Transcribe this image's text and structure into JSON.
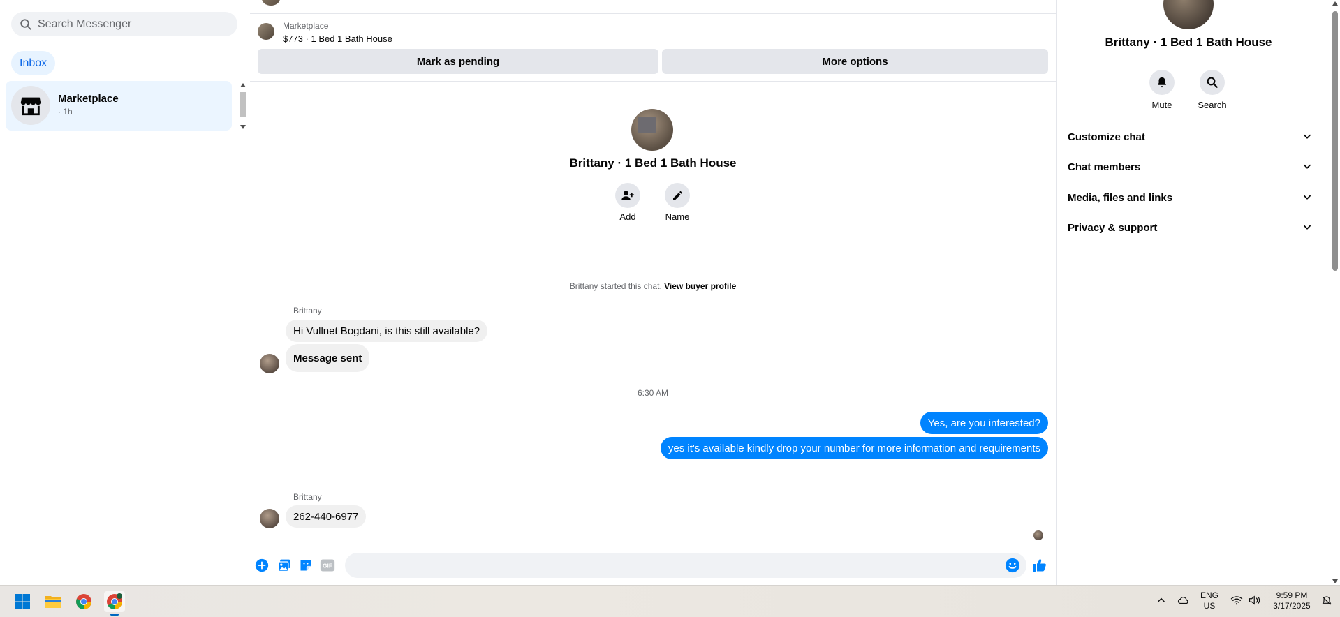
{
  "sidebar": {
    "search_placeholder": "Search Messenger",
    "inbox_tab": "Inbox",
    "conversation": {
      "title": "Marketplace",
      "time": "· 1h"
    }
  },
  "listing": {
    "source": "Marketplace",
    "item": "$773 · 1 Bed 1 Bath House",
    "mark_pending": "Mark as pending",
    "more_options": "More options"
  },
  "chat_header": {
    "name": "Brittany · 1 Bed 1 Bath House",
    "add_label": "Add",
    "name_label": "Name"
  },
  "thread": {
    "started_text": "Brittany started this chat.",
    "view_profile": "View buyer profile",
    "sender": "Brittany",
    "msg1": "Hi Vullnet Bogdani, is this still available?",
    "msg2": "Message sent",
    "timestamp": "6:30 AM",
    "reply1": "Yes, are you interested?",
    "reply2": "yes it's available kindly drop your number for more information and requirements",
    "sender2": "Brittany",
    "msg3": "262-440-6977"
  },
  "right_panel": {
    "name": "Brittany · 1 Bed 1 Bath House",
    "mute": "Mute",
    "search": "Search",
    "rows": [
      "Customize chat",
      "Chat members",
      "Media, files and links",
      "Privacy & support"
    ]
  },
  "taskbar": {
    "lang_top": "ENG",
    "lang_bottom": "US",
    "time": "9:59 PM",
    "date": "3/17/2025"
  },
  "colors": {
    "accent": "#0084ff",
    "inbox_tab_bg": "#e7f3ff",
    "selected_conv_bg": "#ebf5ff"
  }
}
